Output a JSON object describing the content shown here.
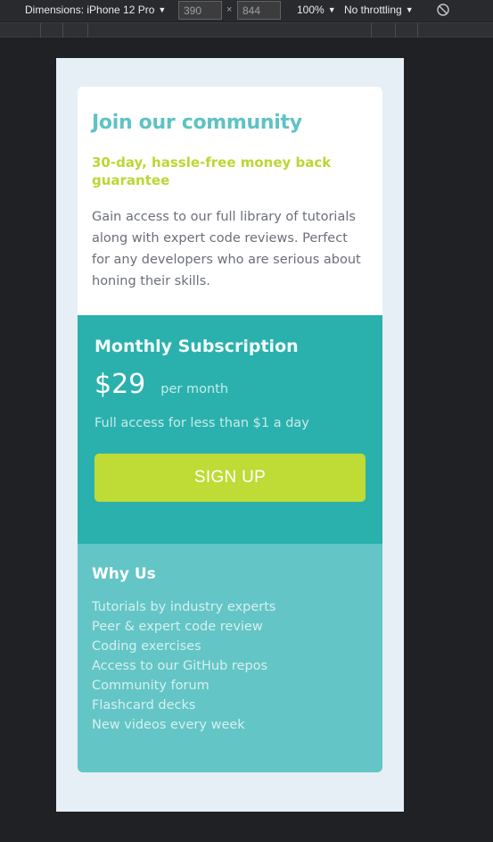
{
  "devtools": {
    "dimensions_label": "Dimensions: iPhone 12 Pro",
    "width_value": "390",
    "height_value": "844",
    "times_glyph": "×",
    "zoom_label": "100%",
    "throttling_label": "No throttling",
    "caret_glyph": "▼",
    "colors": {
      "bar_bg": "#292a2d",
      "text": "#e8eaed"
    }
  },
  "page": {
    "title": "Join our community",
    "subtitle": "30-day, hassle-free money back guarantee",
    "description": "Gain access to our full library of tutorials along with expert code reviews. Perfect for any developers who are serious about honing their skills."
  },
  "subscription": {
    "heading": "Monthly Subscription",
    "price": "$29",
    "period": "per month",
    "tagline": "Full access for less than $1 a day",
    "cta_label": "SIGN UP"
  },
  "why_us": {
    "heading": "Why Us",
    "items": [
      "Tutorials by industry experts",
      "Peer & expert code review",
      "Coding exercises",
      "Access to our GitHub repos",
      "Community forum",
      "Flashcard decks",
      "New videos every week"
    ]
  },
  "colors": {
    "cyan": "#5fc2c4",
    "lime": "#bdd634",
    "teal": "#2bb1ad",
    "light_teal": "#63c5c6",
    "viewport_bg": "#e6eef6"
  }
}
